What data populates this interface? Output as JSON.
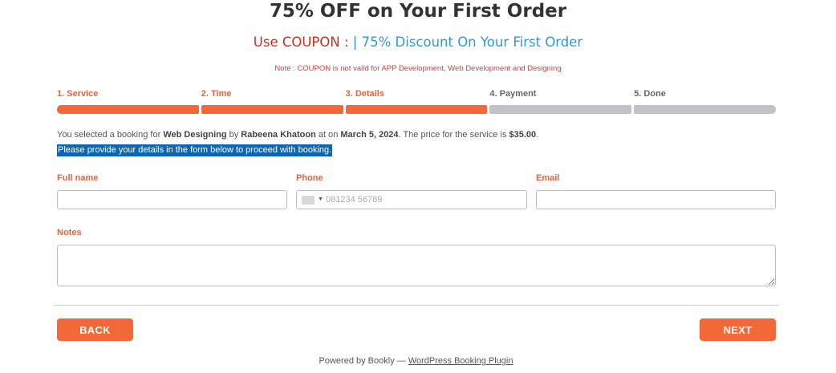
{
  "header": {
    "title": "75% OFF on Your First Order",
    "coupon_label": "Use COUPON :",
    "coupon_separator": "|",
    "coupon_text": "75% Discount On Your First Order",
    "note": "Note : COUPON is not vaild for APP Development, Web Development and Designing"
  },
  "steps": [
    {
      "label": "1. Service",
      "state": "done"
    },
    {
      "label": "2. Time",
      "state": "done"
    },
    {
      "label": "3. Details",
      "state": "done"
    },
    {
      "label": "4. Payment",
      "state": "todo"
    },
    {
      "label": "5. Done",
      "state": "todo"
    }
  ],
  "info": {
    "part1": "You selected a booking for ",
    "service": "Web Designing",
    "part2": " by ",
    "staff": "Rabeena Khatoon",
    "part3": " at on ",
    "date": "March 5, 2024",
    "part4": ". The price for the service is ",
    "price": "$35.00",
    "part5": ".",
    "instruction": "Please provide your details in the form below to proceed with booking."
  },
  "form": {
    "full_name_label": "Full name",
    "full_name_value": "",
    "phone_label": "Phone",
    "phone_placeholder": "081234 56789",
    "email_label": "Email",
    "email_value": "",
    "notes_label": "Notes",
    "notes_value": ""
  },
  "buttons": {
    "back": "BACK",
    "next": "NEXT"
  },
  "footer": {
    "prefix": "Powered by Bookly — ",
    "link": "WordPress Booking Plugin"
  },
  "colors": {
    "accent": "#f26836",
    "inactive_step": "#bfc3c8",
    "highlight": "#0a67b5",
    "coupon_red": "#cc2f1a",
    "coupon_blue": "#2a9bd6"
  }
}
